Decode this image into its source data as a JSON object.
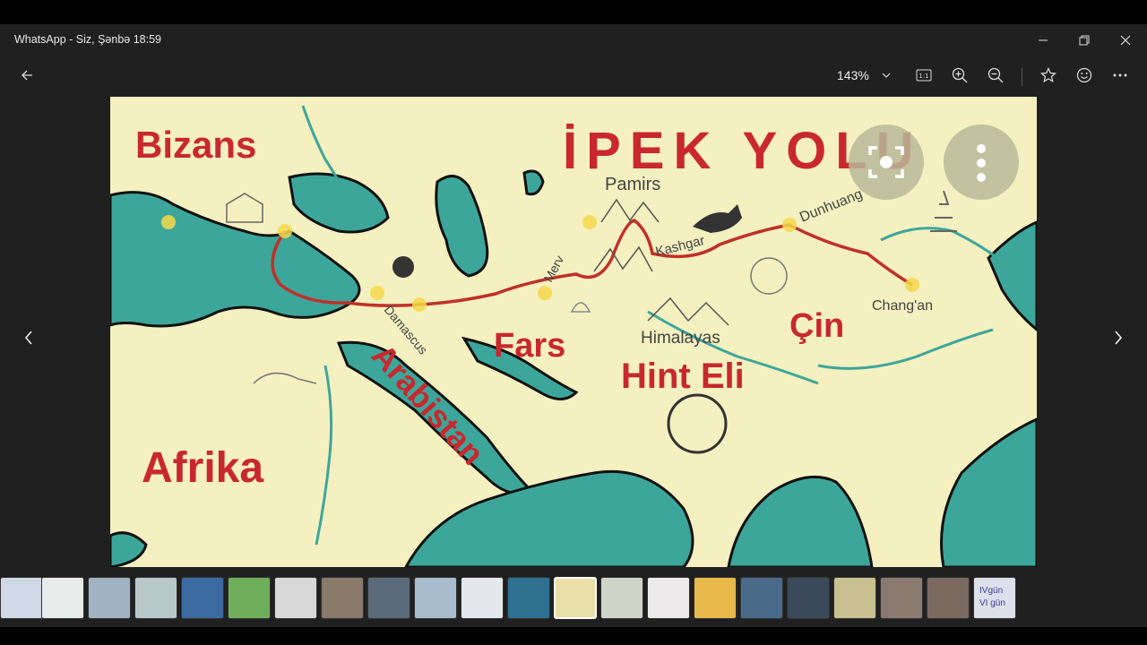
{
  "window": {
    "title": "WhatsApp - Siz, Şənbə 18:59"
  },
  "toolbar": {
    "zoom_value": "143%"
  },
  "map": {
    "title": "İPEK YOLU",
    "regions": {
      "bizans": "Bizans",
      "afrika": "Afrika",
      "arabistan": "Arabistan",
      "fars": "Fars",
      "hint_eli": "Hint Eli",
      "cin": "Çin"
    },
    "places": {
      "pamirs": "Pamirs",
      "dunhuang": "Dunhuang",
      "kashgar": "Kashgar",
      "merv": "Merv",
      "damascus": "Damascus",
      "himalayas": "Himalayas",
      "changan": "Chang'an"
    }
  },
  "thumbnails": {
    "last_label_line1": "IVgün",
    "last_label_line2": "VI gün"
  },
  "colors": {
    "route": "#c0302a",
    "map_land": "#f5f0c0",
    "map_water": "#3da69a",
    "label_red": "#c8282e"
  },
  "icons": [
    "back-arrow-icon",
    "chevron-down-icon",
    "actual-size-icon",
    "zoom-in-icon",
    "zoom-out-icon",
    "star-icon",
    "smiley-icon",
    "more-icon",
    "minimize-icon",
    "restore-icon",
    "close-icon",
    "prev-arrow-icon",
    "next-arrow-icon",
    "lens-icon",
    "kebab-icon"
  ]
}
